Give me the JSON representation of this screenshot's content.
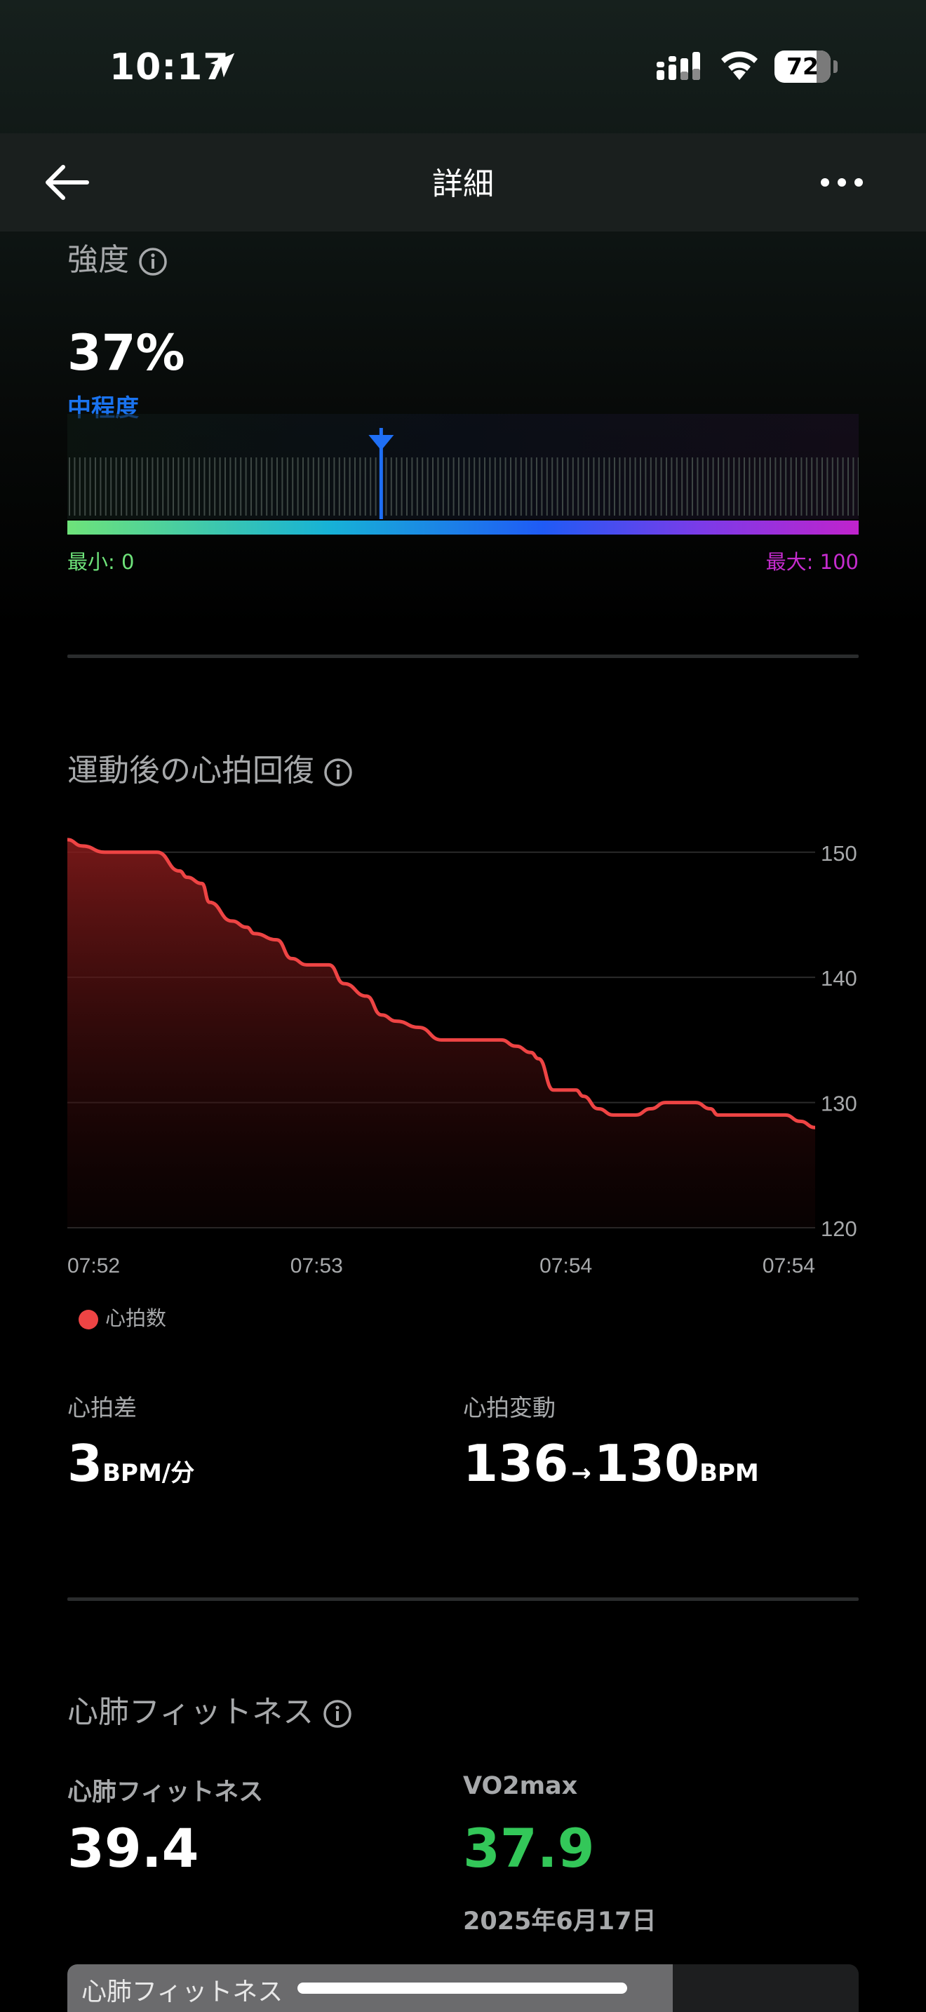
{
  "status_bar": {
    "time": "10:17",
    "battery": "72"
  },
  "nav": {
    "title": "詳細"
  },
  "intensity": {
    "title": "強度",
    "value": "37%",
    "level": "中程度",
    "fraction": 0.37,
    "min_label": "最小: 0",
    "max_label": "最大: 100"
  },
  "recovery": {
    "title": "運動後の心拍回復",
    "legend": "心拍数",
    "stats": {
      "diff_label": "心拍差",
      "diff_value": "3",
      "diff_unit": "BPM/分",
      "change_label": "心拍変動",
      "change_from": "136",
      "change_arrow": "→",
      "change_to": "130",
      "change_unit": "BPM"
    }
  },
  "chart_data": {
    "type": "area",
    "title": "",
    "xlabel": "",
    "ylabel": "",
    "y_ticks": [
      "150",
      "140",
      "130",
      "120"
    ],
    "x_ticks": [
      "07:52",
      "07:53",
      "07:54",
      "07:54"
    ],
    "ylim": [
      120,
      150
    ],
    "grid": true,
    "series": [
      {
        "name": "心拍数",
        "color": "#ee4444",
        "x_fraction": [
          0,
          0.02,
          0.05,
          0.09,
          0.12,
          0.15,
          0.16,
          0.18,
          0.19,
          0.22,
          0.24,
          0.25,
          0.28,
          0.3,
          0.32,
          0.33,
          0.35,
          0.37,
          0.4,
          0.42,
          0.44,
          0.47,
          0.5,
          0.55,
          0.56,
          0.58,
          0.6,
          0.62,
          0.63,
          0.65,
          0.68,
          0.69,
          0.71,
          0.73,
          0.76,
          0.78,
          0.8,
          0.82,
          0.84,
          0.86,
          0.87,
          0.88,
          0.9,
          0.93,
          0.96,
          0.98,
          1.0
        ],
        "values": [
          151,
          150.5,
          150,
          150,
          150,
          148.5,
          148,
          147.5,
          146,
          144.5,
          144,
          143.5,
          143,
          141.5,
          141,
          141,
          141,
          139.5,
          138.5,
          137,
          136.5,
          136,
          135,
          135,
          135,
          135,
          134.5,
          134,
          133.5,
          131,
          131,
          130.5,
          129.5,
          129,
          129,
          129.5,
          130,
          130,
          130,
          129.5,
          129,
          129,
          129,
          129,
          129,
          128.5,
          128
        ]
      }
    ]
  },
  "fitness": {
    "title": "心肺フィットネス",
    "left_label": "心肺フィットネス",
    "left_value": "39.4",
    "right_label": "VO2max",
    "right_value": "37.9",
    "date": "2025年6月17日",
    "bar_label": "心肺フィットネス",
    "bar_fraction": 0.765,
    "accent": "#33c759"
  }
}
